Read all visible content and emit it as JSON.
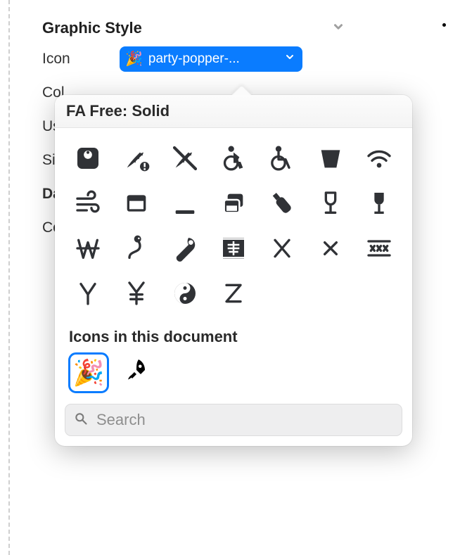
{
  "panel": {
    "section_title": "Graphic Style",
    "rows": {
      "icon_label": "Icon",
      "color_label": "Col",
      "use_label": "Us",
      "size_label": "Siz",
      "data_section": "Da",
      "connect_label": "Co"
    },
    "icon_select": {
      "emoji": "🎉",
      "value": "party-popper-..."
    }
  },
  "popover": {
    "title": "FA Free: Solid",
    "icons": [
      {
        "name": "weight-scale-icon"
      },
      {
        "name": "wheat-alert-icon"
      },
      {
        "name": "wheat-slash-icon"
      },
      {
        "name": "wheelchair-move-icon"
      },
      {
        "name": "wheelchair-icon"
      },
      {
        "name": "whiskey-glass-icon"
      },
      {
        "name": "wifi-icon"
      },
      {
        "name": "wind-icon"
      },
      {
        "name": "window-maximize-icon"
      },
      {
        "name": "window-minimize-icon"
      },
      {
        "name": "window-restore-icon"
      },
      {
        "name": "wine-bottle-icon"
      },
      {
        "name": "wine-glass-empty-icon"
      },
      {
        "name": "wine-glass-icon"
      },
      {
        "name": "won-sign-icon"
      },
      {
        "name": "worm-icon"
      },
      {
        "name": "wrench-icon"
      },
      {
        "name": "x-ray-icon"
      },
      {
        "name": "x-icon"
      },
      {
        "name": "xmark-icon"
      },
      {
        "name": "xmarks-lines-icon"
      },
      {
        "name": "y-icon"
      },
      {
        "name": "yen-sign-icon"
      },
      {
        "name": "yin-yang-icon"
      },
      {
        "name": "z-icon"
      }
    ],
    "doc_section_title": "Icons in this document",
    "doc_icons": [
      {
        "name": "party-popper-icon",
        "glyph": "🎉",
        "selected": true
      },
      {
        "name": "rocket-icon",
        "glyph": "🚀",
        "selected": false
      }
    ],
    "search_placeholder": "Search"
  }
}
